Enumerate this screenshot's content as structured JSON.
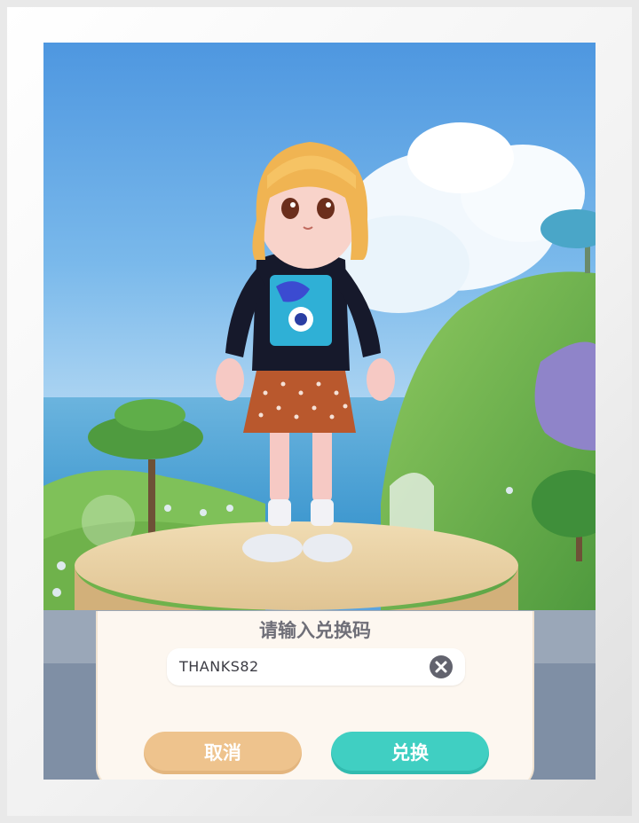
{
  "dialog": {
    "title": "请输入兑换码",
    "code_value": "THANKS82",
    "cancel_label": "取消",
    "redeem_label": "兑换"
  },
  "icons": {
    "clear": "clear-icon",
    "joystick": "joystick-icon"
  },
  "colors": {
    "cancel_button": "#eec38d",
    "redeem_button": "#40cfc2",
    "dialog_background": "#fdf7f0"
  }
}
